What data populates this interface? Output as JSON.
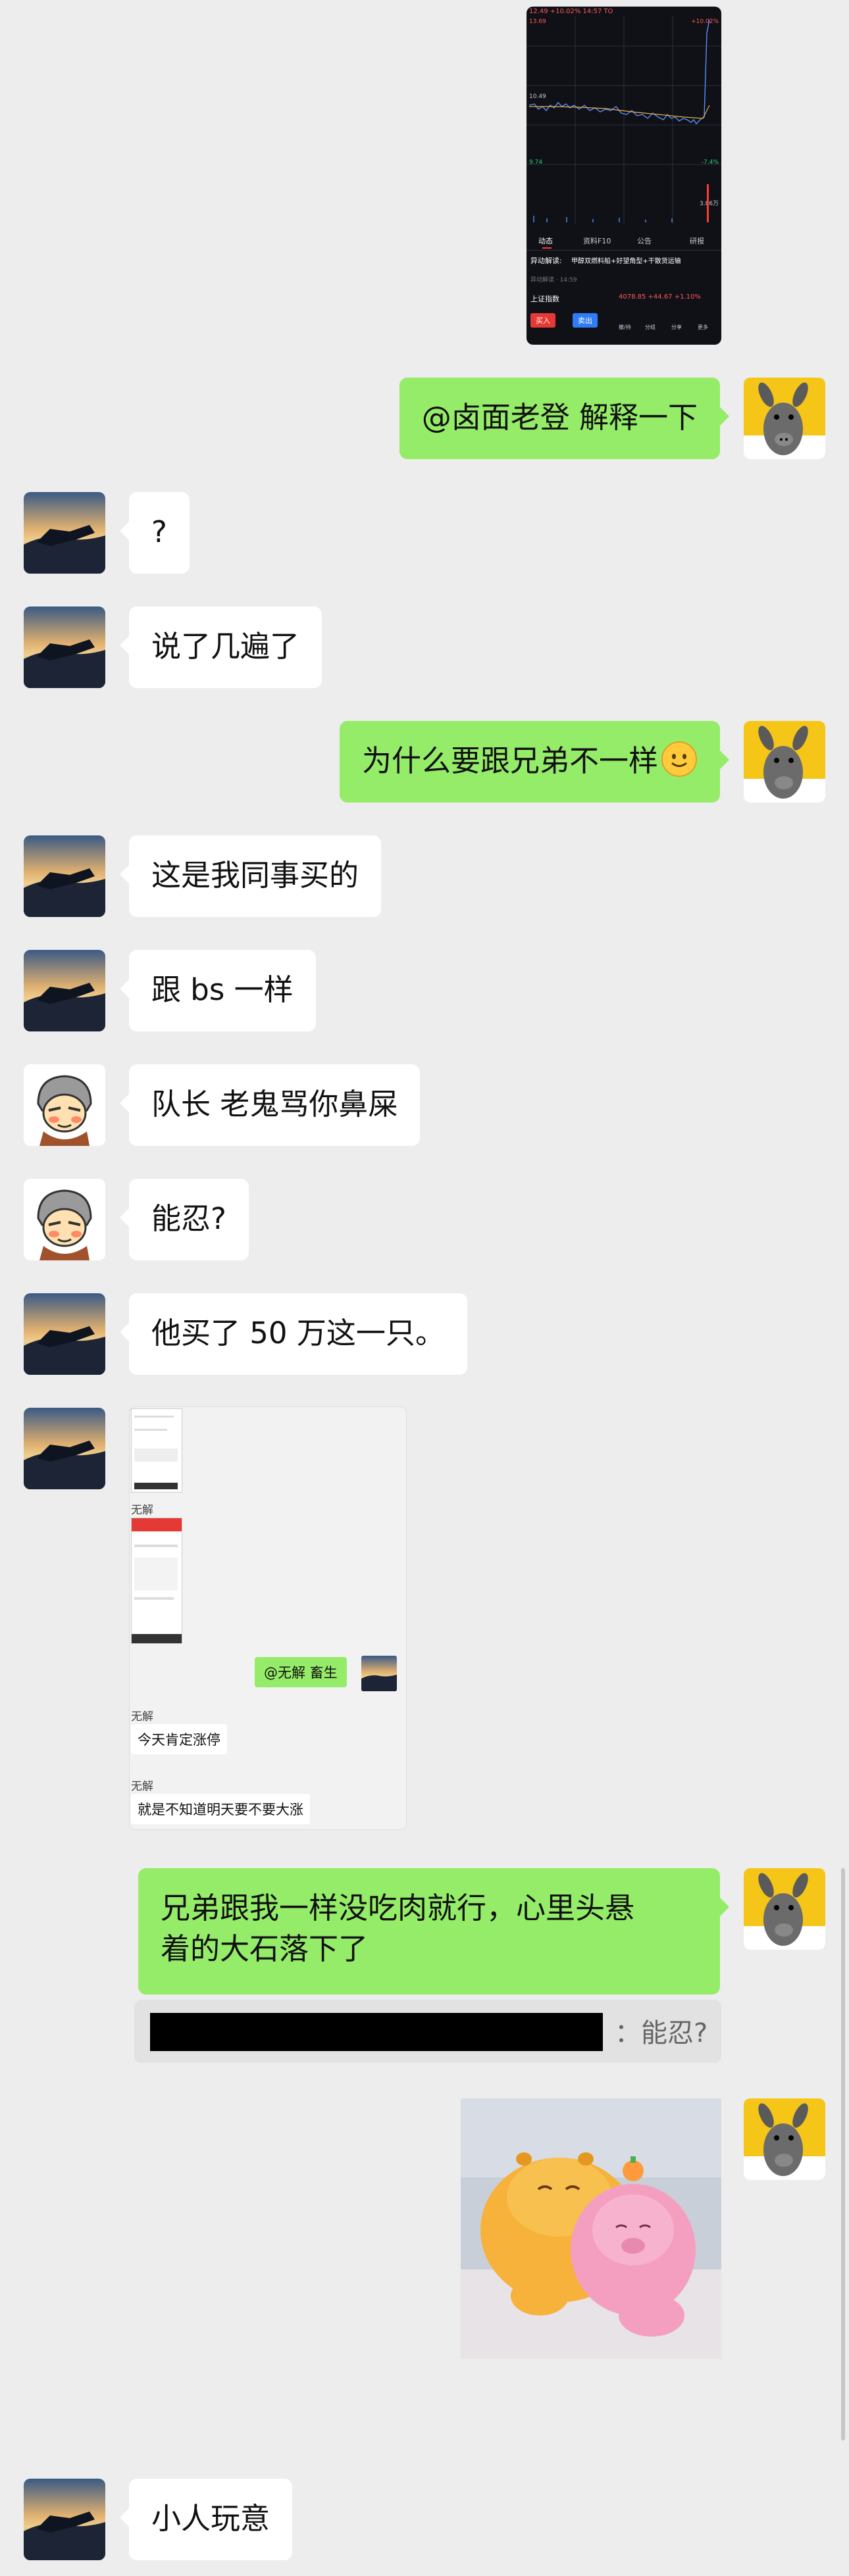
{
  "colors": {
    "background": "#ededed",
    "bubble_in": "#ffffff",
    "bubble_out": "#95ec69",
    "stock_bg": "#0f1116",
    "stock_red": "#ff3b30",
    "stock_green": "#2ecc71"
  },
  "stock_screenshot": {
    "header": "12.49 +10.02% 14:57 TO",
    "price_high": "13.69",
    "price_mid": "10.49",
    "price_low": "9.74",
    "pct_high": "+10.02%",
    "pct_low": "-7.4%",
    "volume_right": "3.86万",
    "tabs": [
      "动态",
      "资料F10",
      "公告",
      "研报"
    ],
    "news_label": "异动解读:",
    "news_text": "甲醇双燃料船+好望角型+干散货运输",
    "source": "异动解读 · 14:59",
    "index_name": "上证指数",
    "index_value": "4078.85 +44.67 +1.10%",
    "buy_label": "买入",
    "sell_label": "卖出",
    "bottom_icons": [
      "撤/持",
      "分组",
      "分享",
      "更多"
    ]
  },
  "messages": [
    {
      "side": "right",
      "text": "@卤面老登 解释一下",
      "avatar": "donkey-avatar"
    },
    {
      "side": "left",
      "text": "?",
      "avatar": "sunset-avatar"
    },
    {
      "side": "left",
      "text": "说了几遍了",
      "avatar": "sunset-avatar"
    },
    {
      "side": "right",
      "text": "为什么要跟兄弟不一样",
      "emoji": "smile-emoji",
      "avatar": "donkey-avatar"
    },
    {
      "side": "left",
      "text": "这是我同事买的",
      "avatar": "sunset-avatar"
    },
    {
      "side": "left",
      "text": "跟 bs 一样",
      "avatar": "sunset-avatar"
    },
    {
      "side": "left",
      "text": "队长 老鬼骂你鼻屎",
      "avatar": "cartoon-avatar"
    },
    {
      "side": "left",
      "text": "能忍?",
      "avatar": "cartoon-avatar"
    },
    {
      "side": "left",
      "text": "他买了 50 万这一只。",
      "avatar": "sunset-avatar"
    },
    {
      "side": "right",
      "text_line1": "兄弟跟我一样没吃肉就行，心里头悬",
      "text_line2": "着的大石落下了",
      "avatar": "donkey-avatar"
    },
    {
      "side": "left",
      "text": "小人玩意",
      "avatar": "sunset-avatar"
    }
  ],
  "forward_record": {
    "sender1": "无解",
    "mention_text": "@无解 畜生",
    "sender2": "无解",
    "msg1": "今天肯定涨停",
    "sender3": "无解",
    "msg2": "就是不知道明天要不要大涨"
  },
  "quote": {
    "text": "：能忍?"
  }
}
